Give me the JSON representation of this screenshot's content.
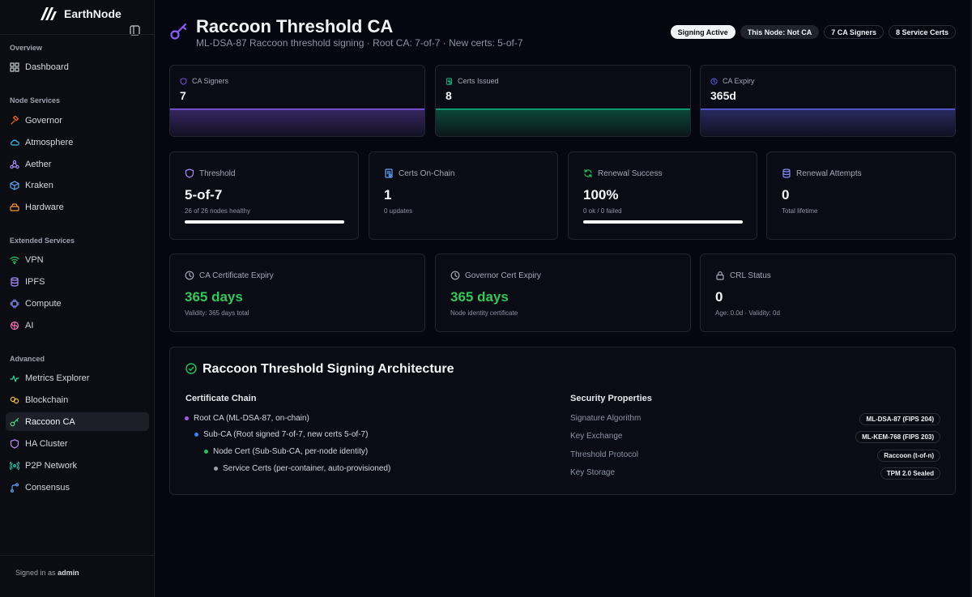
{
  "app": {
    "name": "EarthNode"
  },
  "sidebar": {
    "sections": [
      {
        "label": "Overview",
        "items": [
          {
            "label": "Dashboard",
            "icon": "grid-icon",
            "color": "#c7ccd6"
          }
        ]
      },
      {
        "label": "Node Services",
        "items": [
          {
            "label": "Governor",
            "icon": "gavel-icon",
            "color": "#f97316"
          },
          {
            "label": "Atmosphere",
            "icon": "cloud-icon",
            "color": "#38bdf8"
          },
          {
            "label": "Aether",
            "icon": "network-icon",
            "color": "#a78bfa"
          },
          {
            "label": "Kraken",
            "icon": "cube-icon",
            "color": "#60a5fa"
          },
          {
            "label": "Hardware",
            "icon": "drive-icon",
            "color": "#fb923c"
          }
        ]
      },
      {
        "label": "Extended Services",
        "items": [
          {
            "label": "VPN",
            "icon": "wifi-icon",
            "color": "#22c55e"
          },
          {
            "label": "IPFS",
            "icon": "database-icon",
            "color": "#a78bfa"
          },
          {
            "label": "Compute",
            "icon": "cpu-icon",
            "color": "#818cf8"
          },
          {
            "label": "AI",
            "icon": "brain-icon",
            "color": "#f472b6"
          }
        ]
      },
      {
        "label": "Advanced",
        "items": [
          {
            "label": "Metrics Explorer",
            "icon": "activity-icon",
            "color": "#34d399"
          },
          {
            "label": "Blockchain",
            "icon": "link-icon",
            "color": "#fbbf24"
          },
          {
            "label": "Raccoon CA",
            "icon": "key-icon",
            "color": "#4ade80",
            "active": true
          },
          {
            "label": "HA Cluster",
            "icon": "shield-icon",
            "color": "#c084fc"
          },
          {
            "label": "P2P Network",
            "icon": "broadcast-icon",
            "color": "#2dd4bf"
          },
          {
            "label": "Consensus",
            "icon": "branch-icon",
            "color": "#60a5fa"
          }
        ]
      }
    ],
    "signed_in_prefix": "Signed in as",
    "signed_in_user": "admin"
  },
  "header": {
    "title": "Raccoon Threshold CA",
    "subtitle": "ML-DSA-87 Raccoon threshold signing · Root CA: 7-of-7 · New certs: 5-of-7",
    "badges": [
      {
        "label": "Signing Active",
        "style": "light"
      },
      {
        "label": "This Node: Not CA",
        "style": "dim"
      },
      {
        "label": "7 CA Signers",
        "style": "outline"
      },
      {
        "label": "8 Service Certs",
        "style": "outline"
      }
    ]
  },
  "spark_cards": [
    {
      "label": "CA Signers",
      "value": "7",
      "icon": "shield-icon",
      "color": "#8b5cf6"
    },
    {
      "label": "Certs Issued",
      "value": "8",
      "icon": "certificate-icon",
      "color": "#10b981"
    },
    {
      "label": "CA Expiry",
      "value": "365d",
      "icon": "clock-icon",
      "color": "#6366f1"
    }
  ],
  "stat_cards": [
    {
      "label": "Threshold",
      "value": "5-of-7",
      "sub": "26 of 26 nodes healthy",
      "icon": "shield-icon",
      "color": "#a78bfa",
      "progress": 1.0
    },
    {
      "label": "Certs On-Chain",
      "value": "1",
      "sub": "0 updates",
      "icon": "certificate-icon",
      "color": "#60a5fa"
    },
    {
      "label": "Renewal Success",
      "value": "100%",
      "sub": "0 ok / 0 failed",
      "icon": "refresh-icon",
      "color": "#22c55e",
      "progress": 1.0
    },
    {
      "label": "Renewal Attempts",
      "value": "0",
      "sub": "Total lifetime",
      "icon": "database-icon",
      "color": "#818cf8"
    }
  ],
  "expiry_cards": [
    {
      "label": "CA Certificate Expiry",
      "value": "365 days",
      "sub": "Validity: 365 days total",
      "icon": "clock-icon",
      "green": true
    },
    {
      "label": "Governor Cert Expiry",
      "value": "365 days",
      "sub": "Node identity certificate",
      "icon": "clock-icon",
      "green": true
    },
    {
      "label": "CRL Status",
      "value": "0",
      "sub": "Age: 0.0d · Validity: 0d",
      "icon": "lock-icon",
      "green": false
    }
  ],
  "architecture": {
    "title": "Raccoon Threshold Signing Architecture",
    "chain_title": "Certificate Chain",
    "chain": [
      {
        "label": "Root CA (ML-DSA-87, on-chain)",
        "color": "#a855f7",
        "level": 0
      },
      {
        "label": "Sub-CA (Root signed 7-of-7, new certs 5-of-7)",
        "color": "#3b82f6",
        "level": 1
      },
      {
        "label": "Node Cert (Sub-Sub-CA, per-node identity)",
        "color": "#22c55e",
        "level": 2
      },
      {
        "label": "Service Certs (per-container, auto-provisioned)",
        "color": "#9ca3af",
        "level": 3
      }
    ],
    "props_title": "Security Properties",
    "properties": [
      {
        "label": "Signature Algorithm",
        "value": "ML-DSA-87 (FIPS 204)"
      },
      {
        "label": "Key Exchange",
        "value": "ML-KEM-768 (FIPS 203)"
      },
      {
        "label": "Threshold Protocol",
        "value": "Raccoon (t-of-n)"
      },
      {
        "label": "Key Storage",
        "value": "TPM 2.0 Sealed"
      }
    ]
  },
  "colors": {
    "accent": "#8b5cf6",
    "success": "#34c759",
    "background": "#05060f"
  }
}
